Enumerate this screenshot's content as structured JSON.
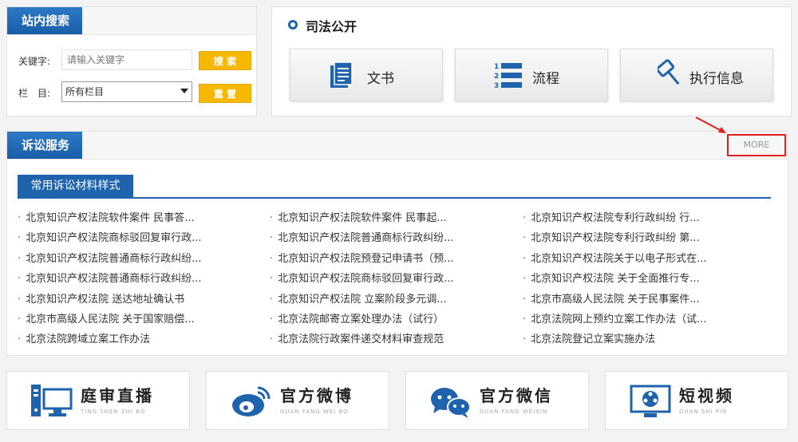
{
  "search": {
    "title": "站内搜索",
    "keyword_label": "关键字:",
    "keyword_placeholder": "请输入关键字",
    "column_label": "栏　目:",
    "column_selected": "所有栏目",
    "search_button": "搜 索",
    "reset_button": "重 置"
  },
  "judicial": {
    "title": "司法公开",
    "buttons": [
      {
        "label": "文书",
        "icon": "document-icon"
      },
      {
        "label": "流程",
        "icon": "list-numbered-icon"
      },
      {
        "label": "执行信息",
        "icon": "gavel-icon"
      }
    ]
  },
  "service": {
    "title": "诉讼服务",
    "more": "MORE",
    "tab": "常用诉讼材料样式",
    "columns": [
      [
        "北京知识产权法院软件案件 民事答...",
        "北京知识产权法院商标驳回复审行政...",
        "北京知识产权法院普通商标行政纠纷...",
        "北京知识产权法院普通商标行政纠纷...",
        "北京知识产权法院 送达地址确认书",
        "北京市高级人民法院 关于国家赔偿...",
        "北京法院跨域立案工作办法"
      ],
      [
        "北京知识产权法院软件案件 民事起...",
        "北京知识产权法院普通商标行政纠纷...",
        "北京知识产权法院预登记申请书（预...",
        "北京知识产权法院商标驳回复审行政...",
        "北京知识产权法院 立案阶段多元调...",
        "北京法院邮寄立案处理办法（试行）",
        "北京法院行政案件递交材料审查规范"
      ],
      [
        "北京知识产权法院专利行政纠纷 行...",
        "北京知识产权法院专利行政纠纷 第...",
        "北京知识产权法院关于以电子形式在...",
        "北京知识产权法院 关于全面推行专...",
        "北京市高级人民法院 关于民事案件...",
        "北京法院网上预约立案工作办法（试...",
        "北京法院登记立案实施办法"
      ]
    ]
  },
  "bottom": [
    {
      "title": "庭审直播",
      "sub": "TING SHEN ZHI BO",
      "icon": "computer-icon"
    },
    {
      "title": "官方微博",
      "sub": "GUAN FANG WEI BO",
      "icon": "weibo-icon"
    },
    {
      "title": "官方微信",
      "sub": "GUAN FANG WEIXIN",
      "icon": "wechat-icon"
    },
    {
      "title": "短视频",
      "sub": "DUAN SHI PIN",
      "icon": "video-icon"
    }
  ]
}
